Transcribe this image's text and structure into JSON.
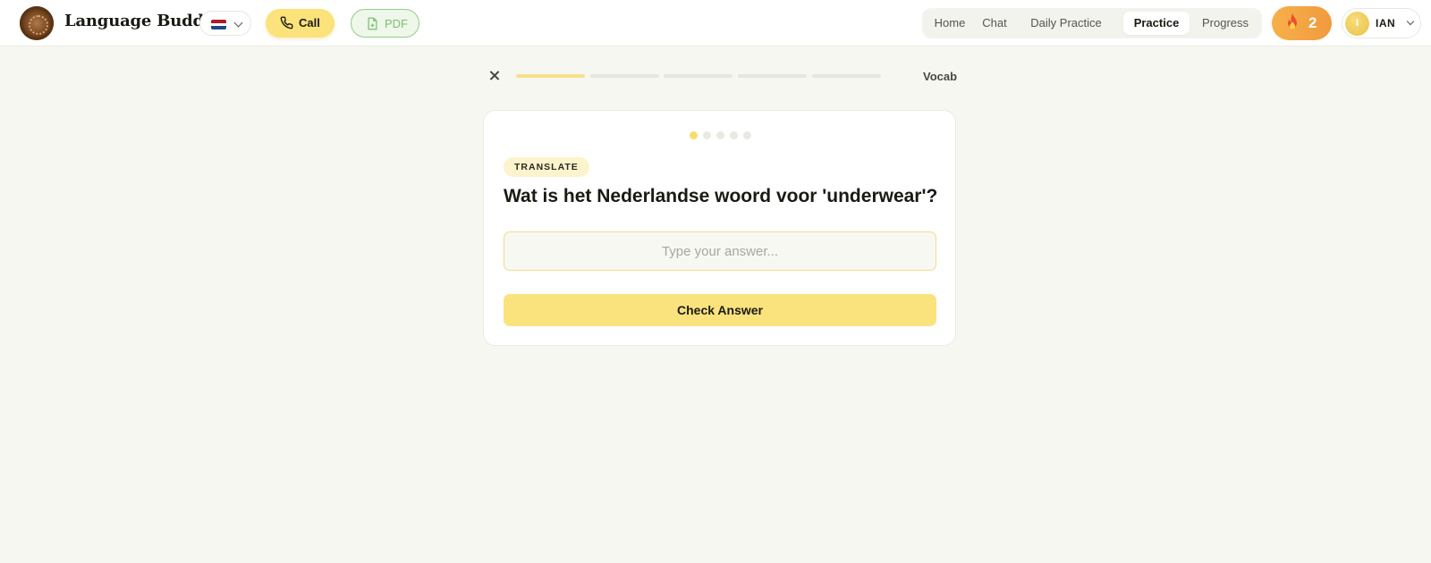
{
  "app": {
    "brand": "Language Buddy",
    "language_flag": "netherlands-flag",
    "call_label": "Call",
    "pdf_label": "PDF"
  },
  "nav": {
    "items": [
      {
        "label": "Home",
        "active": false
      },
      {
        "label": "Chat",
        "active": false
      },
      {
        "label": "Daily Practice",
        "active": false
      },
      {
        "label": "Practice",
        "active": true
      },
      {
        "label": "Progress",
        "active": false
      }
    ]
  },
  "streak": {
    "count": "2",
    "icon": "flame-icon"
  },
  "user": {
    "initial": "I",
    "name": "IAN"
  },
  "session": {
    "category": "Vocab",
    "progress_segments": 5,
    "segments_completed": 1,
    "question_dots": 5,
    "current_question": 1
  },
  "exercise": {
    "tag": "TRANSLATE",
    "question": "Wat is het Nederlandse woord voor 'underwear'?",
    "answer_value": "",
    "answer_placeholder": "Type your answer...",
    "check_label": "Check Answer"
  },
  "colors": {
    "accent_yellow": "#fae37c",
    "streak_orange": "#f29a3e",
    "pdf_green": "#7fbf73",
    "background": "#f7f7f2"
  }
}
